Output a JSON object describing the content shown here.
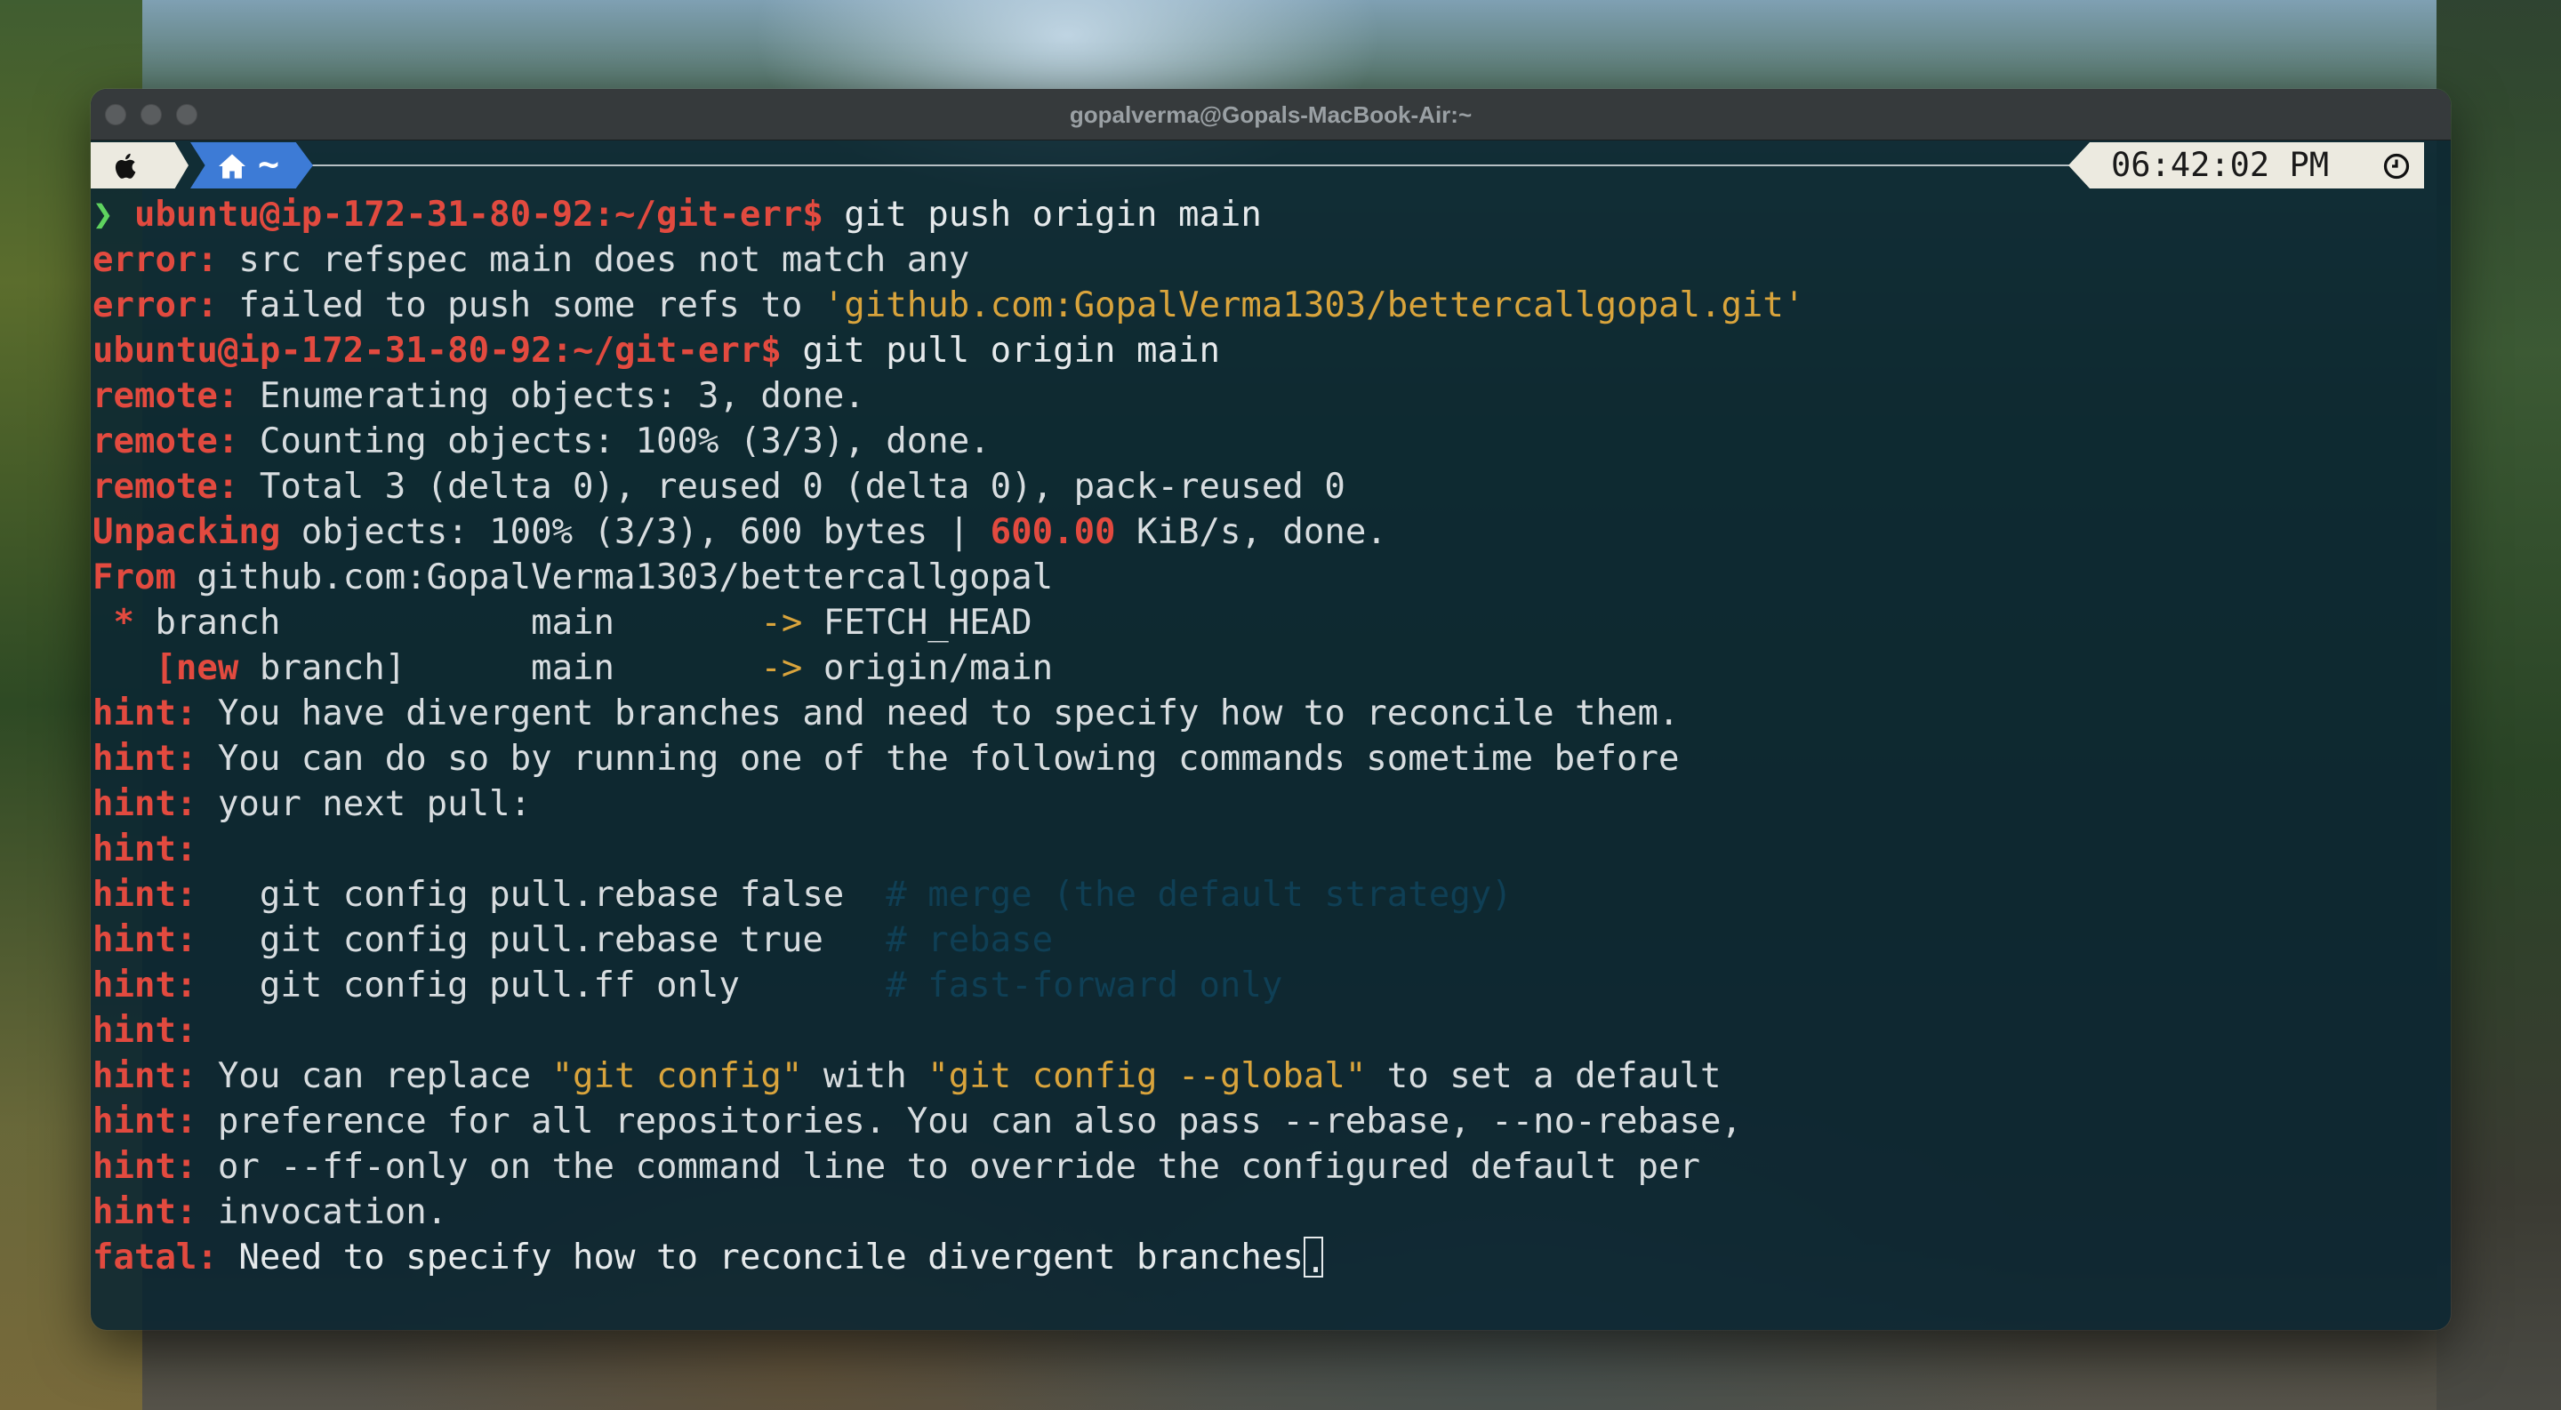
{
  "window": {
    "title": "gopalverma@Gopals-MacBook-Air:~"
  },
  "promptbar": {
    "home_label": "~",
    "time": "06:42:02 PM"
  },
  "colors": {
    "prompt_red": "#e24a3f",
    "prompt_green": "#5fd35f",
    "string_yellow": "#d9a43c",
    "home_blue": "#3d7bd6",
    "terminal_bg": "#0a2632"
  },
  "terminal": {
    "lines": [
      [
        {
          "t": "❯ ",
          "c": "green"
        },
        {
          "t": "ubuntu@ip-172-31-80-92:~/git-err$",
          "c": "red"
        },
        {
          "t": " git push origin main",
          "c": "white"
        }
      ],
      [
        {
          "t": "error:",
          "c": "red"
        },
        {
          "t": " src refspec main does not match any",
          "c": ""
        }
      ],
      [
        {
          "t": "error:",
          "c": "red"
        },
        {
          "t": " failed to push some refs to ",
          "c": ""
        },
        {
          "t": "'github.com:GopalVerma1303/bettercallgopal.git'",
          "c": "yellow"
        }
      ],
      [
        {
          "t": "ubuntu@ip-172-31-80-92:~/git-err$",
          "c": "red"
        },
        {
          "t": " git pull origin main",
          "c": "white"
        }
      ],
      [
        {
          "t": "remote:",
          "c": "red"
        },
        {
          "t": " Enumerating objects: 3, done.",
          "c": ""
        }
      ],
      [
        {
          "t": "remote:",
          "c": "red"
        },
        {
          "t": " Counting objects: 100% (3/3), done.",
          "c": ""
        }
      ],
      [
        {
          "t": "remote:",
          "c": "red"
        },
        {
          "t": " Total 3 (delta 0), reused 0 (delta 0), pack-reused 0",
          "c": ""
        }
      ],
      [
        {
          "t": "Unpacking",
          "c": "red"
        },
        {
          "t": " objects: 100% (3/3), 600 bytes | ",
          "c": ""
        },
        {
          "t": "600.00",
          "c": "red"
        },
        {
          "t": " KiB/s, done.",
          "c": ""
        }
      ],
      [
        {
          "t": "From",
          "c": "red"
        },
        {
          "t": " github.com:GopalVerma1303/bettercallgopal",
          "c": ""
        }
      ],
      [
        {
          "t": " * ",
          "c": "red"
        },
        {
          "t": "branch            main       ",
          "c": ""
        },
        {
          "t": "->",
          "c": "yellow"
        },
        {
          "t": " FETCH_HEAD",
          "c": ""
        }
      ],
      [
        {
          "t": "   [new",
          "c": "red"
        },
        {
          "t": " branch]      main       ",
          "c": ""
        },
        {
          "t": "->",
          "c": "yellow"
        },
        {
          "t": " origin/main",
          "c": ""
        }
      ],
      [
        {
          "t": "hint:",
          "c": "red"
        },
        {
          "t": " You have divergent branches and need to specify how to reconcile them.",
          "c": ""
        }
      ],
      [
        {
          "t": "hint:",
          "c": "red"
        },
        {
          "t": " You can do so by running one of the following commands sometime before",
          "c": ""
        }
      ],
      [
        {
          "t": "hint:",
          "c": "red"
        },
        {
          "t": " your next pull:",
          "c": ""
        }
      ],
      [
        {
          "t": "hint:",
          "c": "red"
        }
      ],
      [
        {
          "t": "hint:",
          "c": "red"
        },
        {
          "t": "   git config pull.rebase false  ",
          "c": ""
        },
        {
          "t": "# merge (the default strategy)",
          "c": "dim"
        }
      ],
      [
        {
          "t": "hint:",
          "c": "red"
        },
        {
          "t": "   git config pull.rebase true   ",
          "c": ""
        },
        {
          "t": "# rebase",
          "c": "dim"
        }
      ],
      [
        {
          "t": "hint:",
          "c": "red"
        },
        {
          "t": "   git config pull.ff only       ",
          "c": ""
        },
        {
          "t": "# fast-forward only",
          "c": "dim"
        }
      ],
      [
        {
          "t": "hint:",
          "c": "red"
        }
      ],
      [
        {
          "t": "hint:",
          "c": "red"
        },
        {
          "t": " You can replace ",
          "c": ""
        },
        {
          "t": "\"git config\"",
          "c": "yellow"
        },
        {
          "t": " with ",
          "c": ""
        },
        {
          "t": "\"git config --global\"",
          "c": "yellow"
        },
        {
          "t": " to set a default",
          "c": ""
        }
      ],
      [
        {
          "t": "hint:",
          "c": "red"
        },
        {
          "t": " preference for all repositories. You can also pass --rebase, --no-rebase,",
          "c": ""
        }
      ],
      [
        {
          "t": "hint:",
          "c": "red"
        },
        {
          "t": " or --ff-only on the command line to override the configured default per",
          "c": ""
        }
      ],
      [
        {
          "t": "hint:",
          "c": "red"
        },
        {
          "t": " invocation.",
          "c": ""
        }
      ],
      [
        {
          "t": "fatal:",
          "c": "red"
        },
        {
          "t": " Need to specify how to reconcile divergent branches",
          "c": "white"
        },
        {
          "t": ".",
          "c": "cursor"
        }
      ]
    ]
  }
}
